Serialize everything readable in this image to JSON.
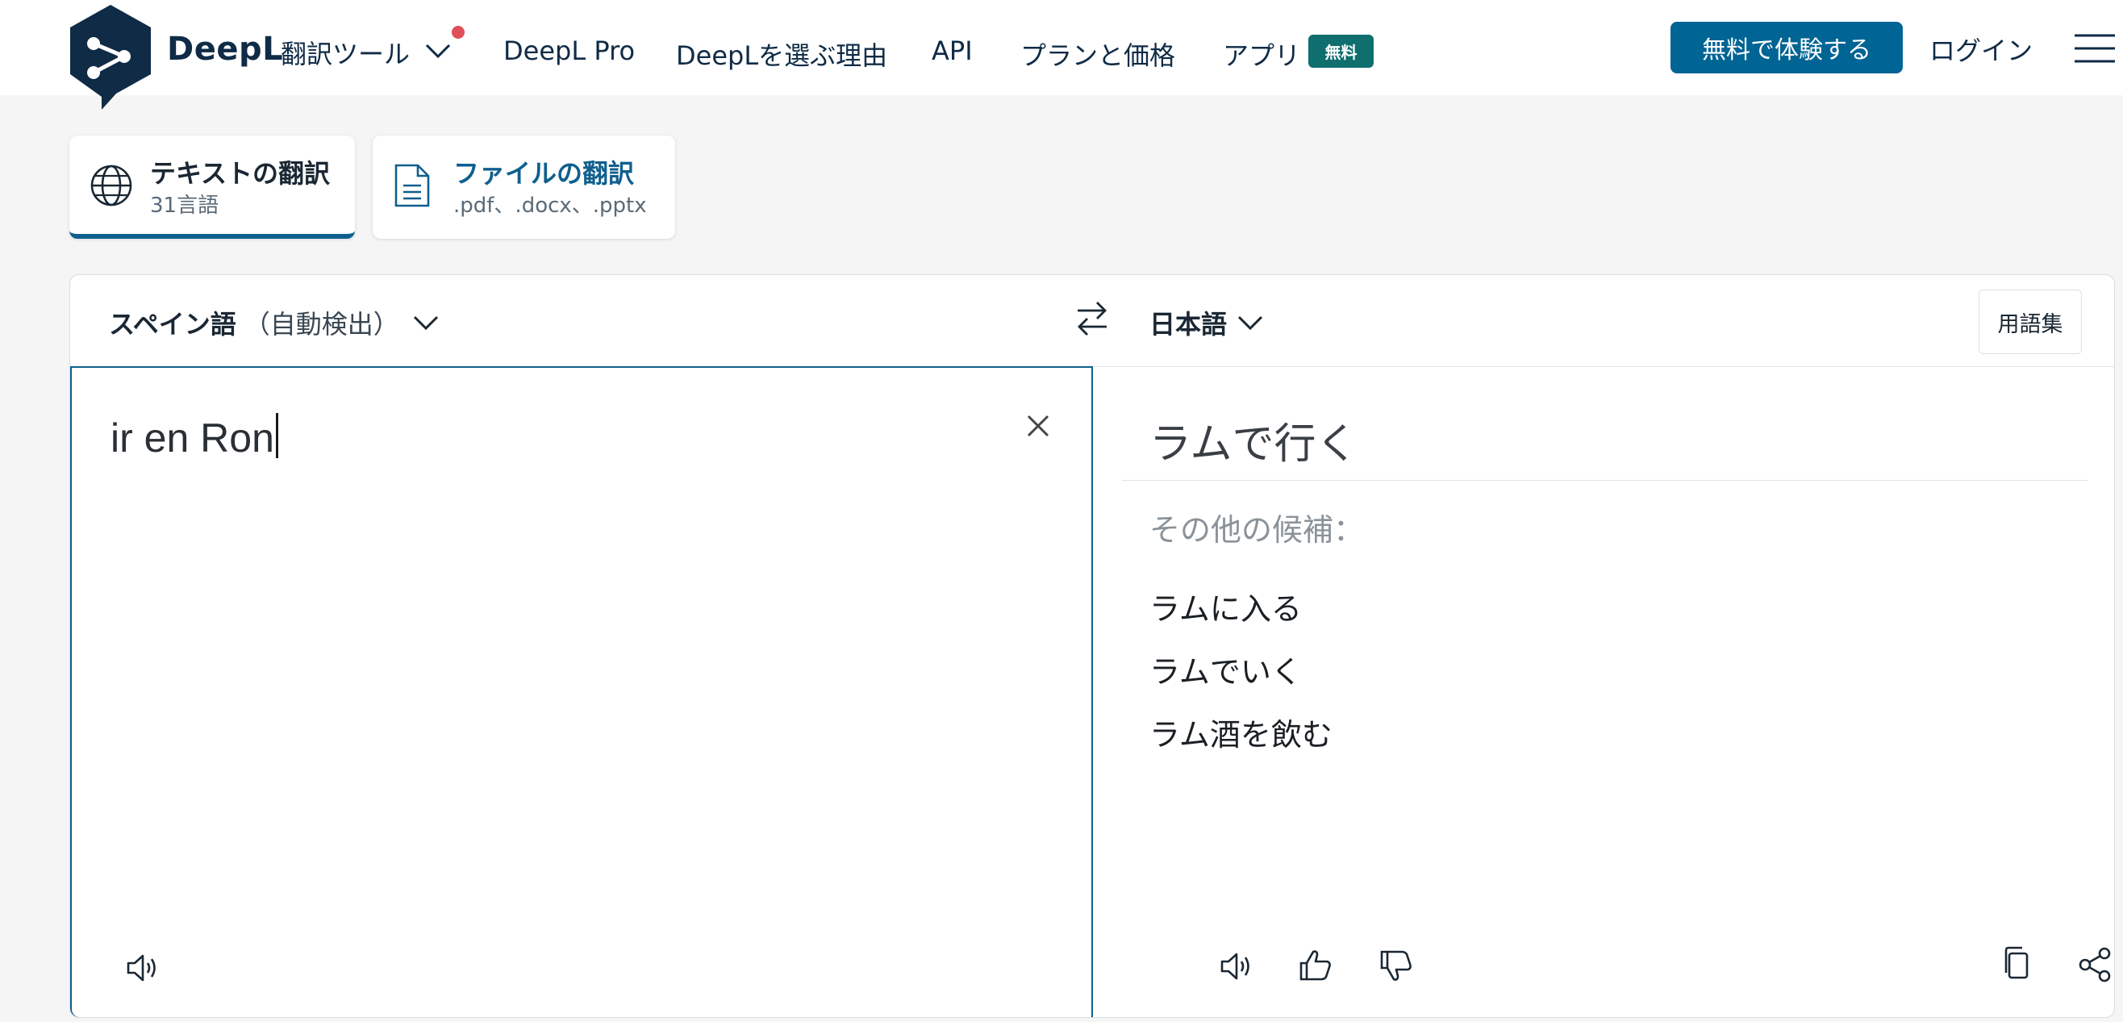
{
  "header": {
    "brand": "DeepL",
    "brand_sub": "翻訳ツール",
    "nav": [
      {
        "label": "DeepL Pro"
      },
      {
        "label": "DeepLを選ぶ理由"
      },
      {
        "label": "API"
      },
      {
        "label": "プランと価格"
      },
      {
        "label": "アプリ"
      }
    ],
    "badge_free": "無料",
    "cta": "無料で体験する",
    "login": "ログイン"
  },
  "tabs": {
    "text": {
      "title": "テキストの翻訳",
      "sub": "31言語"
    },
    "file": {
      "title": "ファイルの翻訳",
      "sub": ".pdf、.docx、.pptx"
    }
  },
  "translator": {
    "source_lang": "スペイン語",
    "source_auto": "（自動検出）",
    "target_lang": "日本語",
    "glossary": "用語集",
    "source_text": "ir en Ron",
    "translation": "ラムで行く",
    "alternatives_label": "その他の候補：",
    "alternatives": [
      "ラムに入る",
      "ラムでいく",
      "ラム酒を飲む"
    ]
  },
  "colors": {
    "brand_navy": "#0f2b46",
    "cta_blue": "#006494",
    "badge_teal": "#0f6e6e",
    "accent_border": "#0f5f8e"
  }
}
